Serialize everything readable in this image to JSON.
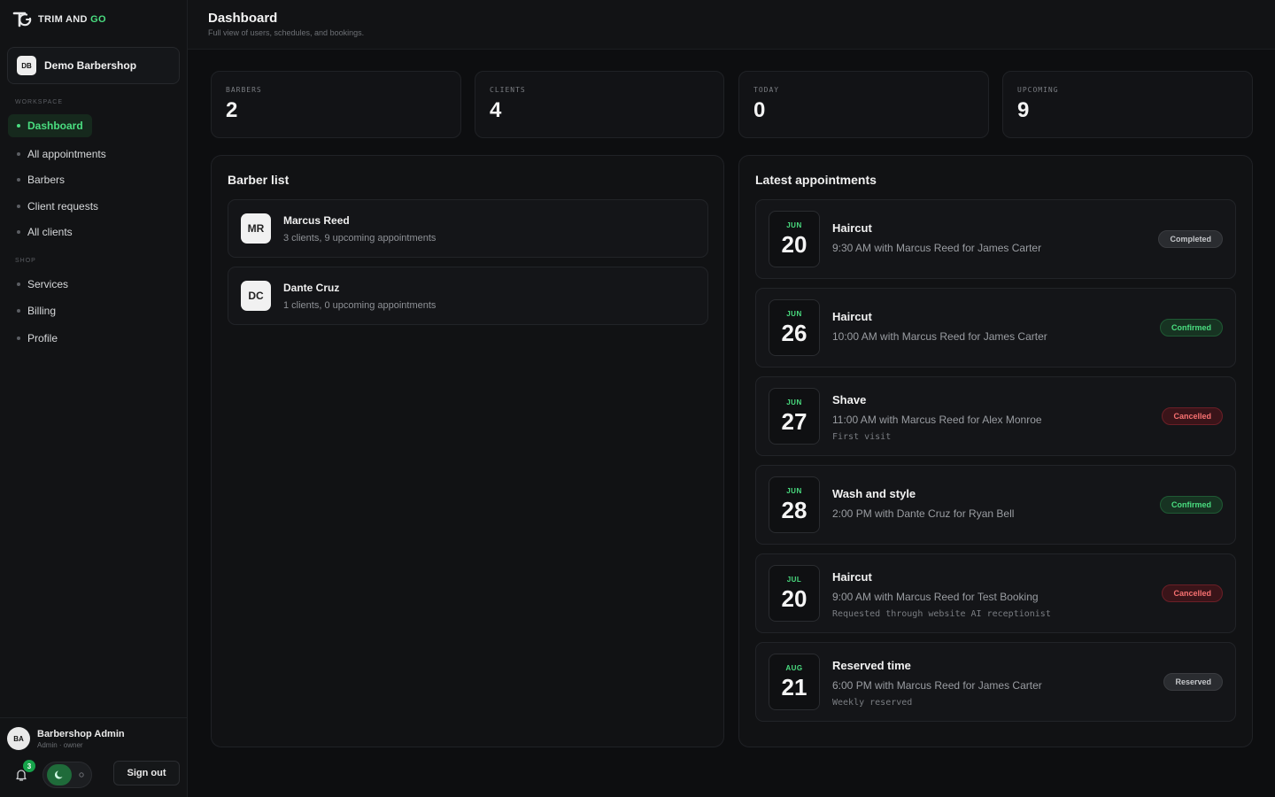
{
  "brand": {
    "name_main": "TRIM AND ",
    "name_accent": "GO"
  },
  "workspace": {
    "initials": "DB",
    "name": "Demo Barbershop"
  },
  "nav": {
    "workspace_label": "WORKSPACE",
    "shop_label": "SHOP",
    "workspace_items": [
      {
        "label": "Dashboard",
        "active": true
      },
      {
        "label": "All appointments"
      },
      {
        "label": "Barbers"
      },
      {
        "label": "Client requests"
      },
      {
        "label": "All clients"
      }
    ],
    "shop_items": [
      {
        "label": "Services"
      },
      {
        "label": "Billing"
      },
      {
        "label": "Profile"
      }
    ]
  },
  "user": {
    "initials": "BA",
    "name": "Barbershop Admin",
    "role": "Admin · owner",
    "notifications": "3",
    "signout_label": "Sign out"
  },
  "header": {
    "title": "Dashboard",
    "subtitle": "Full view of users, schedules, and bookings."
  },
  "stats": [
    {
      "label": "BARBERS",
      "value": "2"
    },
    {
      "label": "CLIENTS",
      "value": "4"
    },
    {
      "label": "TODAY",
      "value": "0"
    },
    {
      "label": "UPCOMING",
      "value": "9"
    }
  ],
  "barber_list": {
    "title": "Barber list",
    "items": [
      {
        "initials": "MR",
        "name": "Marcus Reed",
        "meta": "3 clients, 9 upcoming appointments"
      },
      {
        "initials": "DC",
        "name": "Dante Cruz",
        "meta": "1 clients, 0 upcoming appointments"
      }
    ]
  },
  "appointments": {
    "title": "Latest appointments",
    "items": [
      {
        "month": "JUN",
        "day": "20",
        "service": "Haircut",
        "detail": "9:30 AM with Marcus Reed for James Carter",
        "note": "",
        "status": "Completed",
        "status_type": "completed"
      },
      {
        "month": "JUN",
        "day": "26",
        "service": "Haircut",
        "detail": "10:00 AM with Marcus Reed for James Carter",
        "note": "",
        "status": "Confirmed",
        "status_type": "confirmed"
      },
      {
        "month": "JUN",
        "day": "27",
        "service": "Shave",
        "detail": "11:00 AM with Marcus Reed for Alex Monroe",
        "note": "First visit",
        "status": "Cancelled",
        "status_type": "cancelled"
      },
      {
        "month": "JUN",
        "day": "28",
        "service": "Wash and style",
        "detail": "2:00 PM with Dante Cruz for Ryan Bell",
        "note": "",
        "status": "Confirmed",
        "status_type": "confirmed"
      },
      {
        "month": "JUL",
        "day": "20",
        "service": "Haircut",
        "detail": "9:00 AM with Marcus Reed for Test Booking",
        "note": "Requested through website AI receptionist",
        "status": "Cancelled",
        "status_type": "cancelled"
      },
      {
        "month": "AUG",
        "day": "21",
        "service": "Reserved time",
        "detail": "6:00 PM with Marcus Reed for James Carter",
        "note": "Weekly reserved",
        "status": "Reserved",
        "status_type": "reserved"
      }
    ]
  },
  "colors": {
    "accent": "#4ade80",
    "background": "#0d0e10",
    "cancelled": "#f87171"
  },
  "icons": [
    "logo-icon",
    "bell-icon",
    "moon-icon",
    "sun-icon"
  ]
}
